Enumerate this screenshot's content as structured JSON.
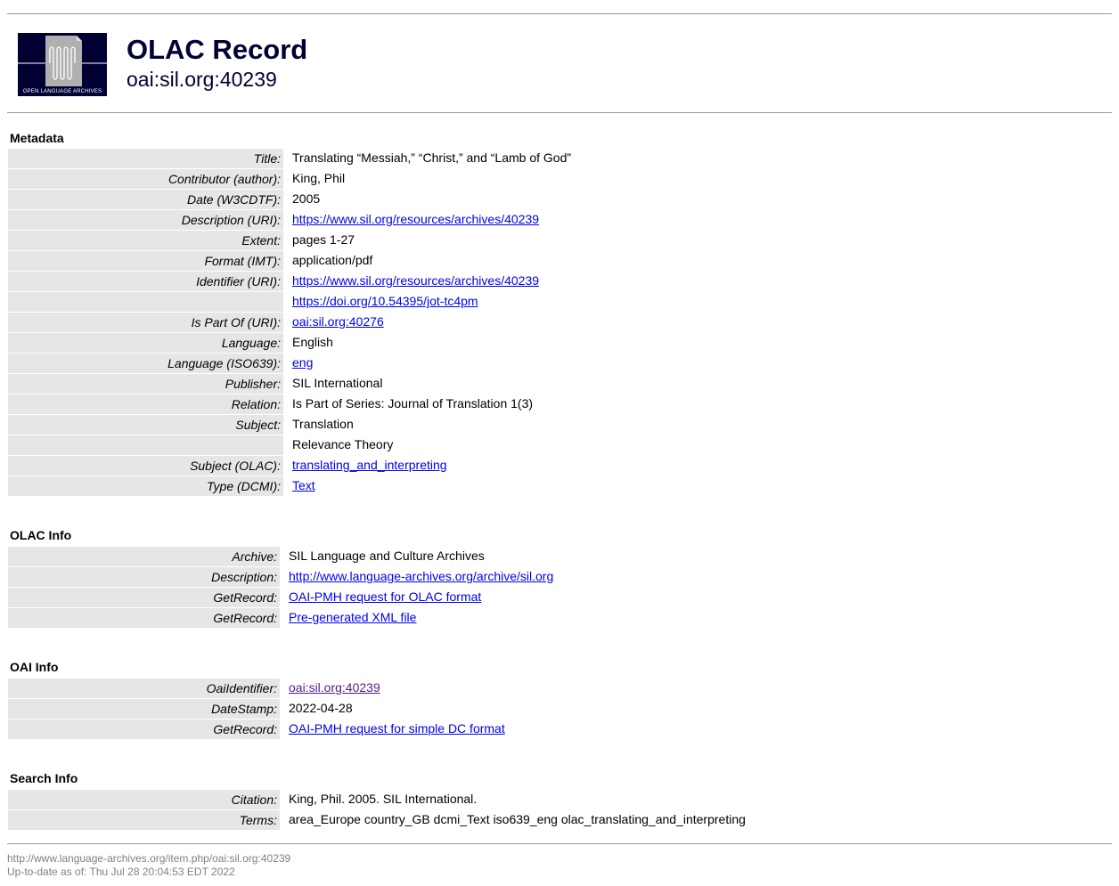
{
  "header": {
    "logo_text": "OPEN LANGUAGE ARCHIVES",
    "title": "OLAC Record",
    "identifier": "oai:sil.org:40239"
  },
  "metadata": {
    "heading": "Metadata",
    "rows": [
      {
        "label": "Title:",
        "value": "Translating “Messiah,” “Christ,” and “Lamb of God”",
        "link": false
      },
      {
        "label": "Contributor (author):",
        "value": "King, Phil",
        "link": false
      },
      {
        "label": "Date (W3CDTF):",
        "value": "2005",
        "link": false
      },
      {
        "label": "Description (URI):",
        "value": "https://www.sil.org/resources/archives/40239",
        "link": true
      },
      {
        "label": "Extent:",
        "value": "pages 1-27",
        "link": false
      },
      {
        "label": "Format (IMT):",
        "value": "application/pdf",
        "link": false
      },
      {
        "label": "Identifier (URI):",
        "value": "https://www.sil.org/resources/archives/40239",
        "link": true
      },
      {
        "label": "",
        "value": "https://doi.org/10.54395/jot-tc4pm",
        "link": true
      },
      {
        "label": "Is Part Of (URI):",
        "value": "oai:sil.org:40276",
        "link": true
      },
      {
        "label": "Language:",
        "value": "English",
        "link": false
      },
      {
        "label": "Language (ISO639):",
        "value": "eng",
        "link": true
      },
      {
        "label": "Publisher:",
        "value": "SIL International",
        "link": false
      },
      {
        "label": "Relation:",
        "value": "Is Part of Series: Journal of Translation 1(3)",
        "link": false
      },
      {
        "label": "Subject:",
        "value": "Translation",
        "link": false
      },
      {
        "label": "",
        "value": "Relevance Theory",
        "link": false
      },
      {
        "label": "Subject (OLAC):",
        "value": "translating_and_interpreting",
        "link": true
      },
      {
        "label": "Type (DCMI):",
        "value": "Text",
        "link": true
      }
    ]
  },
  "olac_info": {
    "heading": "OLAC Info",
    "rows": [
      {
        "label": "Archive:",
        "value": "SIL Language and Culture Archives",
        "link": false
      },
      {
        "label": "Description:",
        "value": "http://www.language-archives.org/archive/sil.org",
        "link": true
      },
      {
        "label": "GetRecord:",
        "value": "OAI-PMH request for OLAC format",
        "link": true
      },
      {
        "label": "GetRecord:",
        "value": "Pre-generated XML file",
        "link": true
      }
    ]
  },
  "oai_info": {
    "heading": "OAI Info",
    "rows": [
      {
        "label": "OaiIdentifier:",
        "value": "oai:sil.org:40239",
        "link": true,
        "visited": true
      },
      {
        "label": "DateStamp:",
        "value": "2022-04-28",
        "link": false
      },
      {
        "label": "GetRecord:",
        "value": "OAI-PMH request for simple DC format",
        "link": true
      }
    ]
  },
  "search_info": {
    "heading": "Search Info",
    "rows": [
      {
        "label": "Citation:",
        "value": "King, Phil. 2005. SIL International.",
        "link": false
      },
      {
        "label": "Terms:",
        "value": "area_Europe country_GB dcmi_Text iso639_eng olac_translating_and_interpreting",
        "link": false
      }
    ]
  },
  "footer": {
    "url": "http://www.language-archives.org/item.php/oai:sil.org:40239",
    "updated": "Up-to-date as of: Thu Jul 28 20:04:53 EDT 2022"
  },
  "colors": {
    "label_bg": "#e6e6e6",
    "link": "#0000ee",
    "visited_link": "#551a8b",
    "title": "#000033"
  }
}
